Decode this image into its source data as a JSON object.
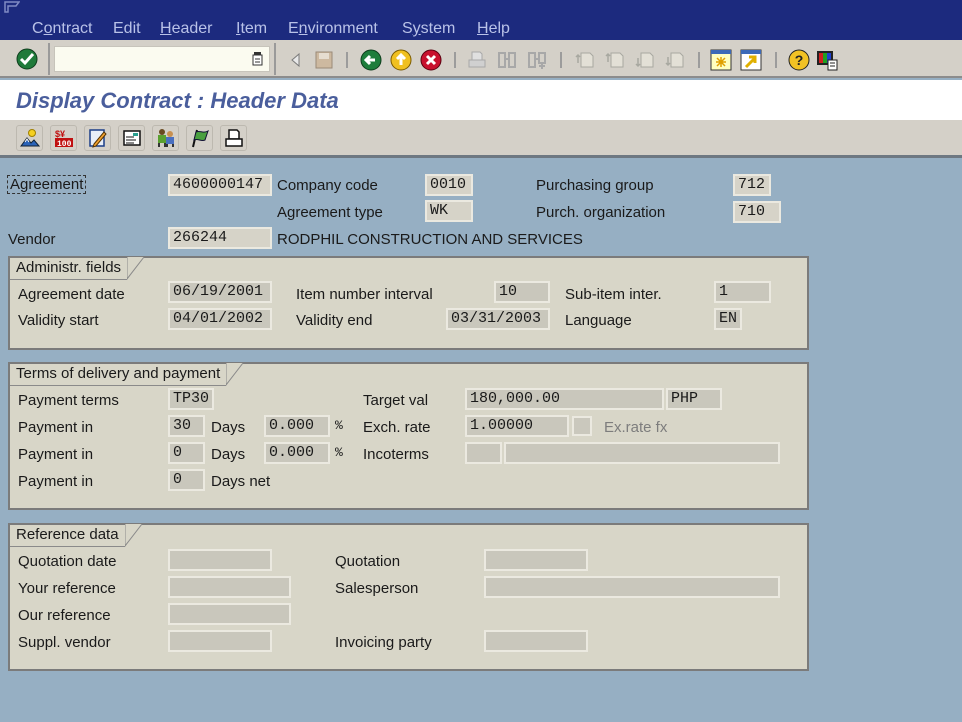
{
  "menu": {
    "items": [
      {
        "pre": "C",
        "ul": "o",
        "post": "ntract"
      },
      {
        "pre": "",
        "ul": "",
        "post": "Edit"
      },
      {
        "pre": "",
        "ul": "H",
        "post": "eader"
      },
      {
        "pre": "",
        "ul": "I",
        "post": "tem"
      },
      {
        "pre": "E",
        "ul": "n",
        "post": "vironment"
      },
      {
        "pre": "S",
        "ul": "y",
        "post": "stem"
      },
      {
        "pre": "",
        "ul": "H",
        "post": "elp"
      }
    ]
  },
  "toolbar": {
    "command_field_value": "",
    "icons": [
      "enter-icon",
      "back-nav-icon",
      "save-icon",
      "back-icon",
      "exit-icon",
      "cancel-icon",
      "print-icon",
      "find-icon",
      "find-next-icon",
      "first-page-icon",
      "previous-page-icon",
      "next-page-icon",
      "last-page-icon",
      "create-session-icon",
      "shortcut-icon",
      "help-icon",
      "layout-menu-icon"
    ]
  },
  "title": "Display Contract : Header Data",
  "app_toolbar": {
    "icons": [
      "header-details-icon",
      "conditions-icon",
      "texts-icon",
      "header-data-icon",
      "partners-icon",
      "status-icon",
      "messages-icon"
    ]
  },
  "header": {
    "agreement_label": "Agreement",
    "agreement_value": "4600000147",
    "company_code_label": "Company code",
    "company_code_value": "0010",
    "agreement_type_label": "Agreement type",
    "agreement_type_value": "WK",
    "purchasing_group_label": "Purchasing group",
    "purchasing_group_value": "712",
    "purch_org_label": "Purch. organization",
    "purch_org_value": "710",
    "vendor_label": "Vendor",
    "vendor_value": "266244",
    "vendor_name": "RODPHIL CONSTRUCTION AND SERVICES"
  },
  "admin": {
    "title": "Administr. fields",
    "agreement_date_label": "Agreement date",
    "agreement_date_value": "06/19/2001",
    "validity_start_label": "Validity start",
    "validity_start_value": "04/01/2002",
    "item_interval_label": "Item number interval",
    "item_interval_value": "10",
    "validity_end_label": "Validity end",
    "validity_end_value": "03/31/2003",
    "subitem_label": "Sub-item inter.",
    "subitem_value": "1",
    "language_label": "Language",
    "language_value": "EN"
  },
  "terms": {
    "title": "Terms of delivery and payment",
    "payment_terms_label": "Payment terms",
    "payment_terms_value": "TP30",
    "payment_in_label": "Payment in",
    "pay1_days": "30",
    "pay1_pct": "0.000",
    "pay2_days": "0",
    "pay2_pct": "0.000",
    "pay3_days": "0",
    "days_label": "Days",
    "days_net_label": "Days net",
    "pct_symbol": "%",
    "target_val_label": "Target val",
    "target_val_value": "180,000.00",
    "currency_value": "PHP",
    "exch_rate_label": "Exch. rate",
    "exch_rate_value": "1.00000",
    "exrate_fx_label": "Ex.rate fx",
    "exrate_fx_checked": false,
    "incoterms_label": "Incoterms",
    "incoterms_value": "",
    "incoterms_desc": ""
  },
  "reference": {
    "title": "Reference data",
    "quotation_date_label": "Quotation date",
    "quotation_date_value": "",
    "your_ref_label": "Your reference",
    "your_ref_value": "",
    "our_ref_label": "Our reference",
    "our_ref_value": "",
    "suppl_vendor_label": "Suppl. vendor",
    "suppl_vendor_value": "",
    "quotation_label": "Quotation",
    "quotation_value": "",
    "salesperson_label": "Salesperson",
    "salesperson_value": "",
    "invoicing_party_label": "Invoicing party",
    "invoicing_party_value": ""
  }
}
